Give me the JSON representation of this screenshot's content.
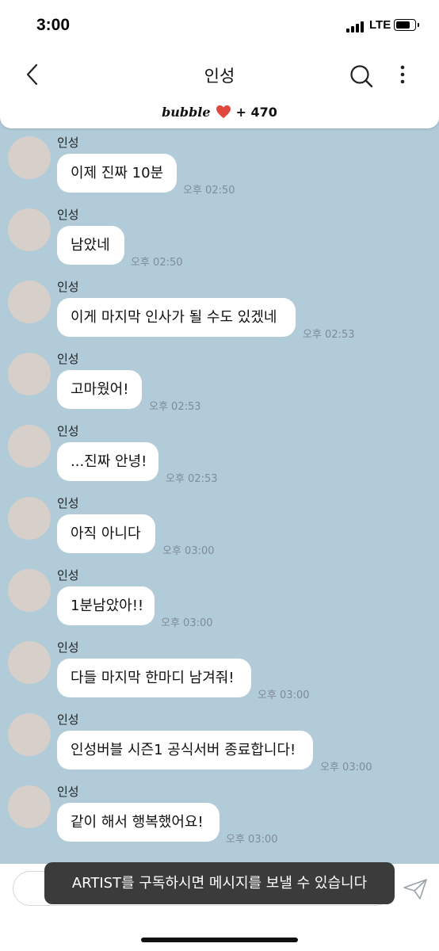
{
  "status_bar": {
    "time": "3:00",
    "network": "LTE",
    "battery_level": 0.75
  },
  "header": {
    "title": "인성"
  },
  "banner": {
    "brand": "bubble",
    "count": "+ 470"
  },
  "messages": [
    {
      "sender": "인성",
      "text": "이제 진짜 10분",
      "time": "오후 02:50"
    },
    {
      "sender": "인성",
      "text": "남았네",
      "time": "오후 02:50"
    },
    {
      "sender": "인성",
      "text": "이게 마지막 인사가 될 수도 있겠네",
      "time": "오후 02:53"
    },
    {
      "sender": "인성",
      "text": "고마웠어!",
      "time": "오후 02:53"
    },
    {
      "sender": "인성",
      "text": "...진짜 안녕!",
      "time": "오후 02:53"
    },
    {
      "sender": "인성",
      "text": "아직 아니다",
      "time": "오후 03:00"
    },
    {
      "sender": "인성",
      "text": "1분남았아!!",
      "time": "오후 03:00"
    },
    {
      "sender": "인성",
      "text": "다들 마지막 한마디 남겨줘!",
      "time": "오후 03:00"
    },
    {
      "sender": "인성",
      "text": "인성버블 시즌1 공식서버 종료합니다!",
      "time": "오후 03:00"
    },
    {
      "sender": "인성",
      "text": "같이 해서 행복했어요!",
      "time": "오후 03:00"
    }
  ],
  "toast": {
    "text": "ARTIST를 구독하시면 메시지를 보낼 수 있습니다"
  },
  "colors": {
    "chat_background": "#b2cbd9",
    "heart": "#e0473f",
    "toast_background": "#3b3b3b"
  }
}
